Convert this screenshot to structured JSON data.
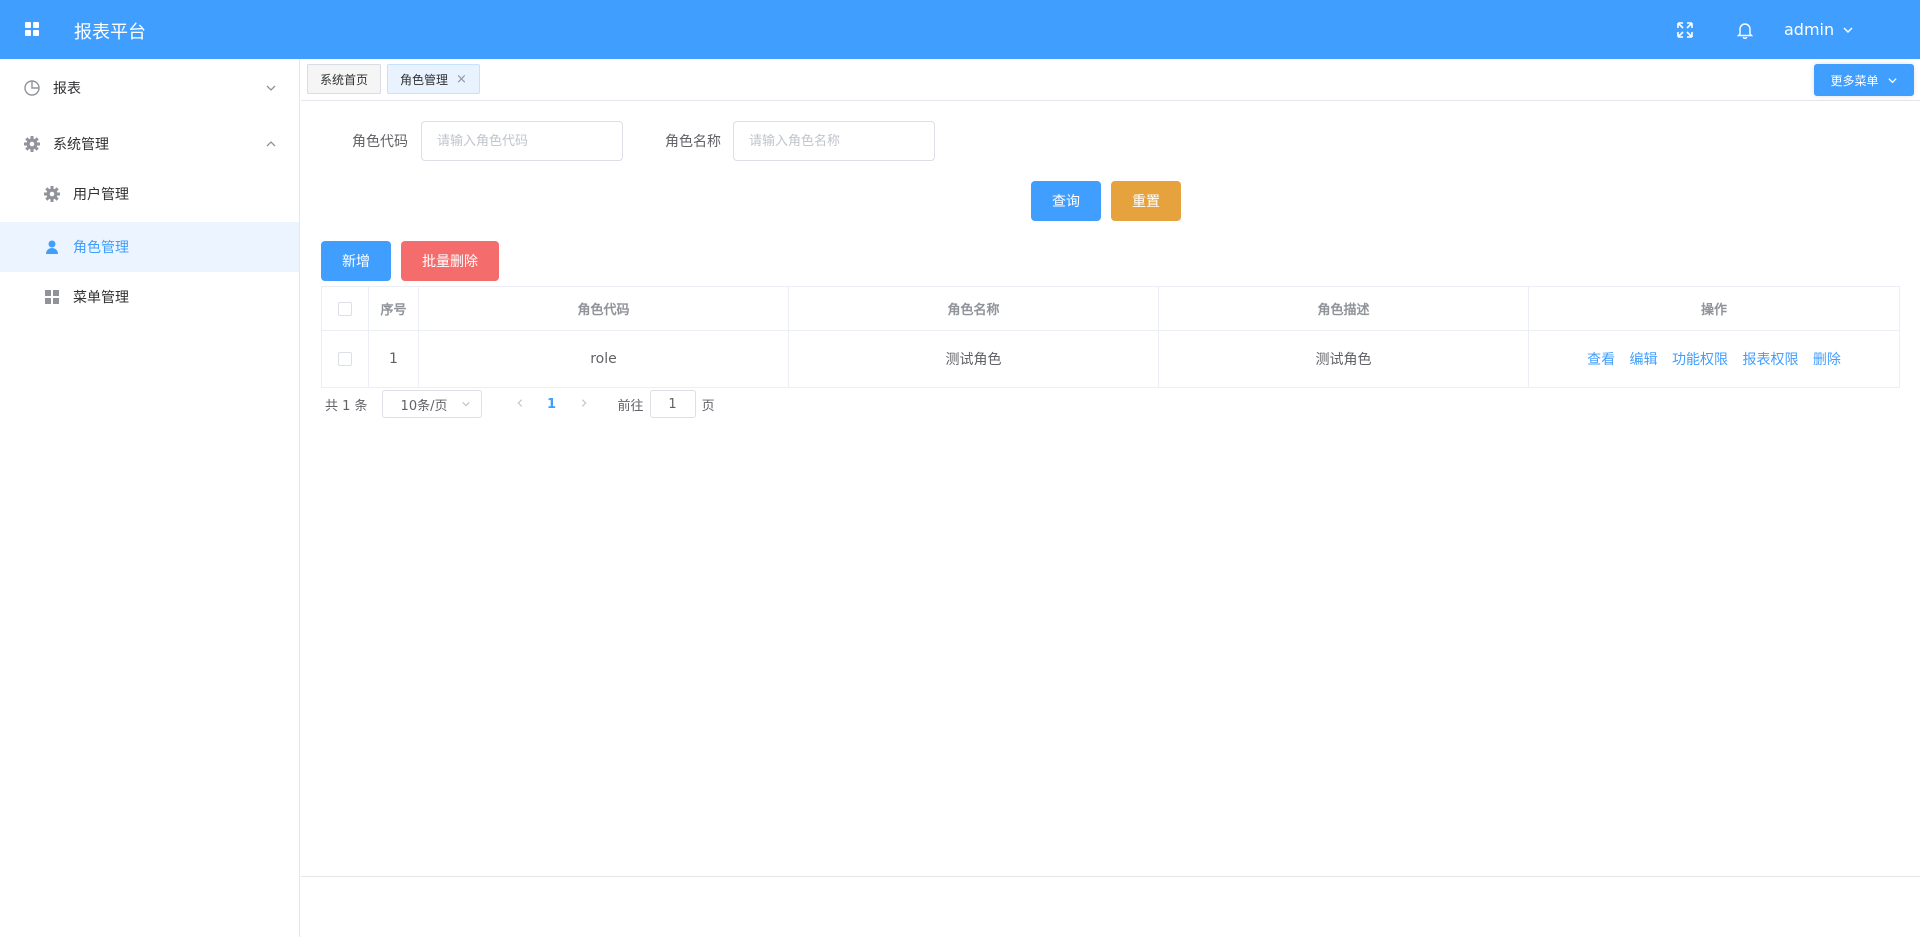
{
  "header": {
    "title": "报表平台",
    "user": "admin"
  },
  "sidebar": {
    "items": [
      {
        "label": "报表",
        "icon": "pie-chart-icon"
      },
      {
        "label": "系统管理",
        "icon": "gear-icon"
      },
      {
        "label": "用户管理",
        "icon": "gear-icon"
      },
      {
        "label": "角色管理",
        "icon": "user-icon"
      },
      {
        "label": "菜单管理",
        "icon": "grid-icon"
      }
    ]
  },
  "tags": {
    "home": "系统首页",
    "active": "角色管理",
    "close": "×",
    "more": "更多菜单"
  },
  "search": {
    "code_label": "角色代码",
    "code_placeholder": "请输入角色代码",
    "name_label": "角色名称",
    "name_placeholder": "请输入角色名称",
    "query": "查询",
    "reset": "重置"
  },
  "actions": {
    "add": "新增",
    "batch_delete": "批量删除"
  },
  "table": {
    "headers": [
      "序号",
      "角色代码",
      "角色名称",
      "角色描述",
      "操作"
    ],
    "rows": [
      {
        "index": "1",
        "code": "role",
        "name": "测试角色",
        "desc": "测试角色"
      }
    ],
    "ops": [
      "查看",
      "编辑",
      "功能权限",
      "报表权限",
      "删除"
    ]
  },
  "pagination": {
    "total": "共 1 条",
    "page_size": "10条/页",
    "current_page": "1",
    "goto_prefix": "前往",
    "goto_value": "1",
    "goto_suffix": "页"
  },
  "colors": {
    "primary": "#409eff",
    "warning": "#e6a23c",
    "danger": "#f56c6c"
  }
}
